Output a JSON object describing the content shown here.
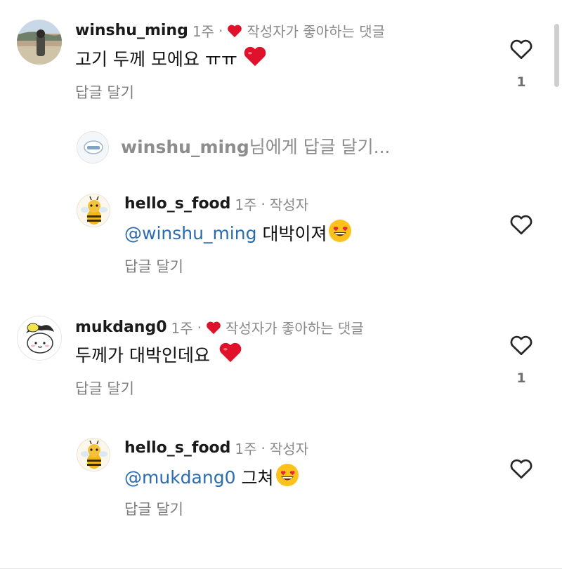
{
  "comments": [
    {
      "username": "winshu_ming",
      "time": "1주",
      "separator": "·",
      "author_liked": "작성자가 좋아하는 댓글",
      "text": "고기 두께 모에요 ㅠㅠ",
      "reply_label": "답글 달기",
      "like_count": "1"
    },
    {
      "username": "mukdang0",
      "time": "1주",
      "separator": "·",
      "author_liked": "작성자가 좋아하는 댓글",
      "text": "두께가 대박인데요",
      "reply_label": "답글 달기",
      "like_count": "1"
    }
  ],
  "reply_input": {
    "prefix": "winshu_ming",
    "suffix": "님에게 답글 달기..."
  },
  "replies": [
    {
      "username": "hello_s_food",
      "time": "1주",
      "separator": "·",
      "role": "작성자",
      "mention": "@winshu_ming",
      "text": "대박이져",
      "reply_label": "답글 달기"
    },
    {
      "username": "hello_s_food",
      "time": "1주",
      "separator": "·",
      "role": "작성자",
      "mention": "@mukdang0",
      "text": "그쳐",
      "reply_label": "답글 달기"
    }
  ],
  "icons": {
    "author_heart": "red-heart-icon",
    "like": "heart-outline-icon",
    "text_emoji_heart": "red-heart-emoji",
    "text_emoji_eyes": "heart-eyes-emoji"
  },
  "colors": {
    "heart_red": "#e0112b",
    "mention_blue": "#2b6cb0",
    "meta_gray": "#8a8a8a"
  }
}
